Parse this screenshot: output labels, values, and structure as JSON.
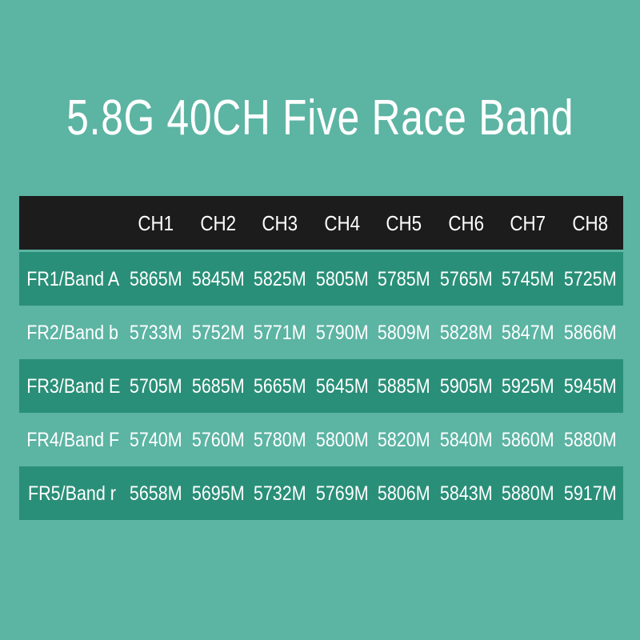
{
  "page": {
    "background_color": "#5cb4a3",
    "band_color": "#2a8f78",
    "header_color": "#1c1c1c",
    "text_color": "#ffffff"
  },
  "title": "5.8G 40CH Five Race Band",
  "table": {
    "corner_label": "",
    "channel_headers": [
      "CH1",
      "CH2",
      "CH3",
      "CH4",
      "CH5",
      "CH6",
      "CH7",
      "CH8"
    ],
    "rows": [
      {
        "band": "FR1/Band A",
        "style": "dark",
        "values": [
          "5865M",
          "5845M",
          "5825M",
          "5805M",
          "5785M",
          "5765M",
          "5745M",
          "5725M"
        ]
      },
      {
        "band": "FR2/Band b",
        "style": "light",
        "values": [
          "5733M",
          "5752M",
          "5771M",
          "5790M",
          "5809M",
          "5828M",
          "5847M",
          "5866M"
        ]
      },
      {
        "band": "FR3/Band E",
        "style": "dark",
        "values": [
          "5705M",
          "5685M",
          "5665M",
          "5645M",
          "5885M",
          "5905M",
          "5925M",
          "5945M"
        ]
      },
      {
        "band": "FR4/Band F",
        "style": "light",
        "values": [
          "5740M",
          "5760M",
          "5780M",
          "5800M",
          "5820M",
          "5840M",
          "5860M",
          "5880M"
        ]
      },
      {
        "band": "FR5/Band r",
        "style": "dark",
        "values": [
          "5658M",
          "5695M",
          "5732M",
          "5769M",
          "5806M",
          "5843M",
          "5880M",
          "5917M"
        ]
      }
    ]
  }
}
